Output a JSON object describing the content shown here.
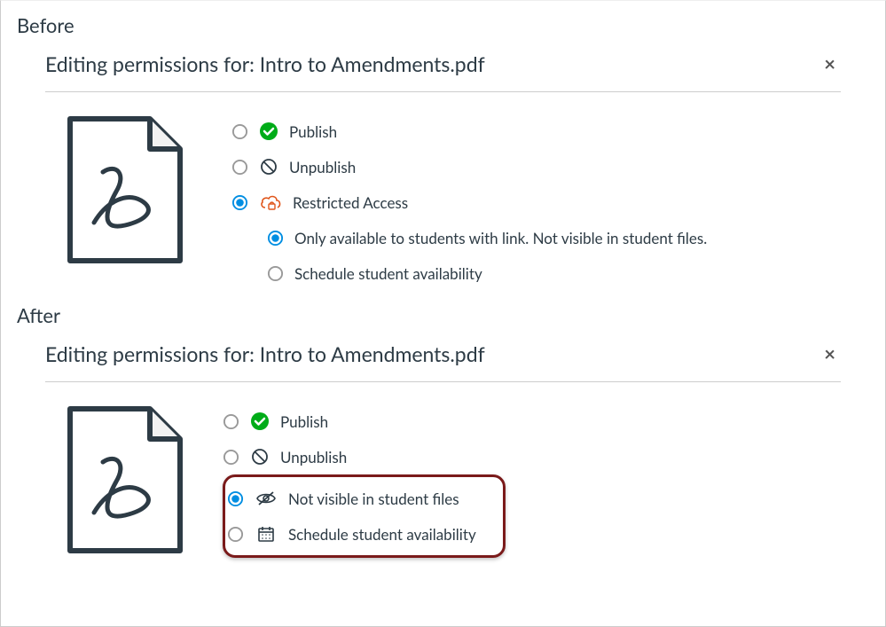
{
  "sections": {
    "before_label": "Before",
    "after_label": "After"
  },
  "before": {
    "header": "Editing permissions for: Intro to Amendments.pdf",
    "close_icon": "close-icon",
    "options": {
      "publish": "Publish",
      "unpublish": "Unpublish",
      "restricted": "Restricted Access",
      "sub_link_only": "Only available to students with link. Not visible in student files.",
      "sub_schedule": "Schedule student availability"
    },
    "selected_main": "restricted",
    "selected_sub": "link_only"
  },
  "after": {
    "header": "Editing permissions for: Intro to Amendments.pdf",
    "close_icon": "close-icon",
    "options": {
      "publish": "Publish",
      "unpublish": "Unpublish",
      "not_visible": "Not visible in student files",
      "schedule": "Schedule student availability"
    },
    "selected_main": "not_visible"
  },
  "icons": {
    "pdf_file": "pdf-file-icon",
    "publish_check": "checkmark-circle-icon",
    "unpublish_ban": "ban-icon",
    "cloud_lock": "cloud-lock-icon",
    "eye_slash": "eye-slash-icon",
    "calendar": "calendar-icon"
  },
  "colors": {
    "publish_green": "#00AC18",
    "selected_blue": "#008EE2",
    "orange": "#E0561B",
    "text": "#2D3B45",
    "muted": "#73818C",
    "highlight_border": "#7a1a1a"
  }
}
